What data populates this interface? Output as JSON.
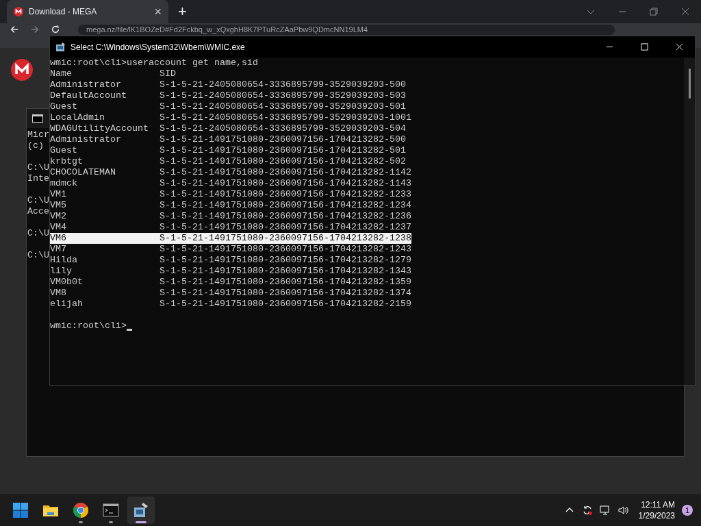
{
  "browser": {
    "tab": {
      "title": "Download - MEGA",
      "close": "×",
      "selected": true
    },
    "new_tab": "+",
    "url": "mega.nz/file/lK1BOZeD#Fd2Fckbq_w_xQxghH8K7PTuRcZAaPbw9QDmcNN19LM4"
  },
  "background_console": {
    "groups": [
      [
        "Micr",
        "(c)"
      ],
      [
        "C:\\U",
        "Inte"
      ],
      [
        "C:\\U",
        "Acce"
      ],
      [
        "C:\\U"
      ],
      [
        "C:\\U"
      ]
    ]
  },
  "console": {
    "title": "Select C:\\Windows\\System32\\Wbem\\WMIC.exe",
    "command_line": "wmic:root\\cli>useraccount get name,sid",
    "columns": [
      "Name",
      "SID"
    ],
    "rows": [
      {
        "name": "Administrator",
        "sid": "S-1-5-21-2405080654-3336895799-3529039203-500",
        "selected": false
      },
      {
        "name": "DefaultAccount",
        "sid": "S-1-5-21-2405080654-3336895799-3529039203-503",
        "selected": false
      },
      {
        "name": "Guest",
        "sid": "S-1-5-21-2405080654-3336895799-3529039203-501",
        "selected": false
      },
      {
        "name": "LocalAdmin",
        "sid": "S-1-5-21-2405080654-3336895799-3529039203-1001",
        "selected": false
      },
      {
        "name": "WDAGUtilityAccount",
        "sid": "S-1-5-21-2405080654-3336895799-3529039203-504",
        "selected": false
      },
      {
        "name": "Administrator",
        "sid": "S-1-5-21-1491751080-2360097156-1704213282-500",
        "selected": false
      },
      {
        "name": "Guest",
        "sid": "S-1-5-21-1491751080-2360097156-1704213282-501",
        "selected": false
      },
      {
        "name": "krbtgt",
        "sid": "S-1-5-21-1491751080-2360097156-1704213282-502",
        "selected": false
      },
      {
        "name": "CHOCOLATEMAN",
        "sid": "S-1-5-21-1491751080-2360097156-1704213282-1142",
        "selected": false
      },
      {
        "name": "mdmck",
        "sid": "S-1-5-21-1491751080-2360097156-1704213282-1143",
        "selected": false
      },
      {
        "name": "VM1",
        "sid": "S-1-5-21-1491751080-2360097156-1704213282-1233",
        "selected": false
      },
      {
        "name": "VM5",
        "sid": "S-1-5-21-1491751080-2360097156-1704213282-1234",
        "selected": false
      },
      {
        "name": "VM2",
        "sid": "S-1-5-21-1491751080-2360097156-1704213282-1236",
        "selected": false
      },
      {
        "name": "VM4",
        "sid": "S-1-5-21-1491751080-2360097156-1704213282-1237",
        "selected": false
      },
      {
        "name": "VM6",
        "sid": "S-1-5-21-1491751080-2360097156-1704213282-1238",
        "selected": true
      },
      {
        "name": "VM7",
        "sid": "S-1-5-21-1491751080-2360097156-1704213282-1243",
        "selected": false
      },
      {
        "name": "Hilda",
        "sid": "S-1-5-21-1491751080-2360097156-1704213282-1279",
        "selected": false
      },
      {
        "name": "lily",
        "sid": "S-1-5-21-1491751080-2360097156-1704213282-1343",
        "selected": false
      },
      {
        "name": "VM0b0t",
        "sid": "S-1-5-21-1491751080-2360097156-1704213282-1359",
        "selected": false
      },
      {
        "name": "VM8",
        "sid": "S-1-5-21-1491751080-2360097156-1704213282-1374",
        "selected": false
      },
      {
        "name": "elijah",
        "sid": "S-1-5-21-1491751080-2360097156-1704213282-2159",
        "selected": false
      }
    ],
    "prompt": "wmic:root\\cli>"
  },
  "taskbar": {
    "apps": [
      {
        "kind": "start",
        "running": false,
        "active": false
      },
      {
        "kind": "folder",
        "running": false,
        "active": false
      },
      {
        "kind": "chrome",
        "running": true,
        "active": false
      },
      {
        "kind": "terminal",
        "running": true,
        "active": false
      },
      {
        "kind": "wmic",
        "running": true,
        "active": true
      }
    ],
    "clock": {
      "time": "12:11 AM",
      "date": "1/29/2023"
    },
    "notification_count": "1"
  }
}
